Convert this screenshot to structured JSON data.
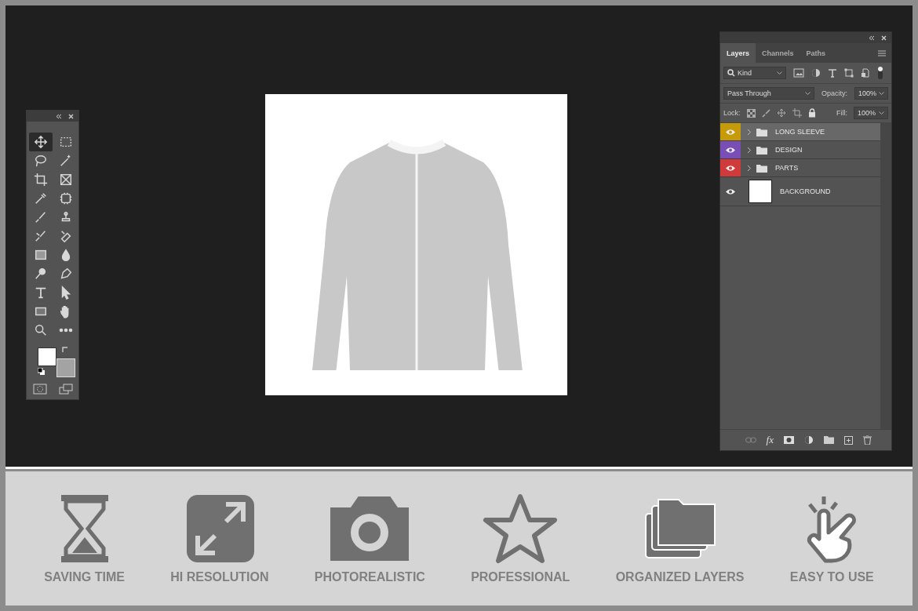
{
  "tools_panel": {
    "tools": [
      {
        "kind": "move",
        "selected": true
      },
      {
        "kind": "marquee",
        "selected": false
      },
      {
        "kind": "lasso",
        "selected": false
      },
      {
        "kind": "wand",
        "selected": false
      },
      {
        "kind": "crop",
        "selected": false
      },
      {
        "kind": "frame",
        "selected": false
      },
      {
        "kind": "eyedropper",
        "selected": false
      },
      {
        "kind": "patch",
        "selected": false
      },
      {
        "kind": "brush",
        "selected": false
      },
      {
        "kind": "stamp",
        "selected": false
      },
      {
        "kind": "history",
        "selected": false
      },
      {
        "kind": "eraser",
        "selected": false
      },
      {
        "kind": "gradient",
        "selected": false
      },
      {
        "kind": "drop",
        "selected": false
      },
      {
        "kind": "dodge",
        "selected": false
      },
      {
        "kind": "pen",
        "selected": false
      },
      {
        "kind": "type",
        "selected": false
      },
      {
        "kind": "select",
        "selected": false
      },
      {
        "kind": "rect",
        "selected": false
      },
      {
        "kind": "hand",
        "selected": false
      },
      {
        "kind": "zoom",
        "selected": false
      },
      {
        "kind": "more",
        "selected": false
      }
    ]
  },
  "layers_panel": {
    "tabs": [
      {
        "label": "Layers",
        "selected": true
      },
      {
        "label": "Channels",
        "selected": false
      },
      {
        "label": "Paths",
        "selected": false
      }
    ],
    "filter": "Kind",
    "blend_mode": "Pass Through",
    "opacity_label": "Opacity:",
    "opacity": "100%",
    "lock_label": "Lock:",
    "fill_label": "Fill:",
    "fill": "100%",
    "layers": [
      {
        "name": "LONG SLEEVE",
        "kind": "group",
        "color": "#c79a0a",
        "visible": true,
        "selected": true
      },
      {
        "name": "DESIGN",
        "kind": "group",
        "color": "#7a4fb5",
        "visible": true,
        "selected": false
      },
      {
        "name": "PARTS",
        "kind": "group",
        "color": "#d03a3a",
        "visible": true,
        "selected": false
      },
      {
        "name": "BACKGROUND",
        "kind": "pixel",
        "color": "#535353",
        "visible": true,
        "selected": false
      }
    ],
    "fx_label": "fx"
  },
  "features": [
    {
      "kind": "hourglass",
      "label": "SAVING TIME"
    },
    {
      "kind": "expand",
      "label": "HI RESOLUTION"
    },
    {
      "kind": "camera",
      "label": "PHOTOREALISTIC"
    },
    {
      "kind": "star",
      "label": "PROFESSIONAL"
    },
    {
      "kind": "folders",
      "label": "ORGANIZED LAYERS"
    },
    {
      "kind": "hand",
      "label": "EASY TO USE"
    }
  ]
}
